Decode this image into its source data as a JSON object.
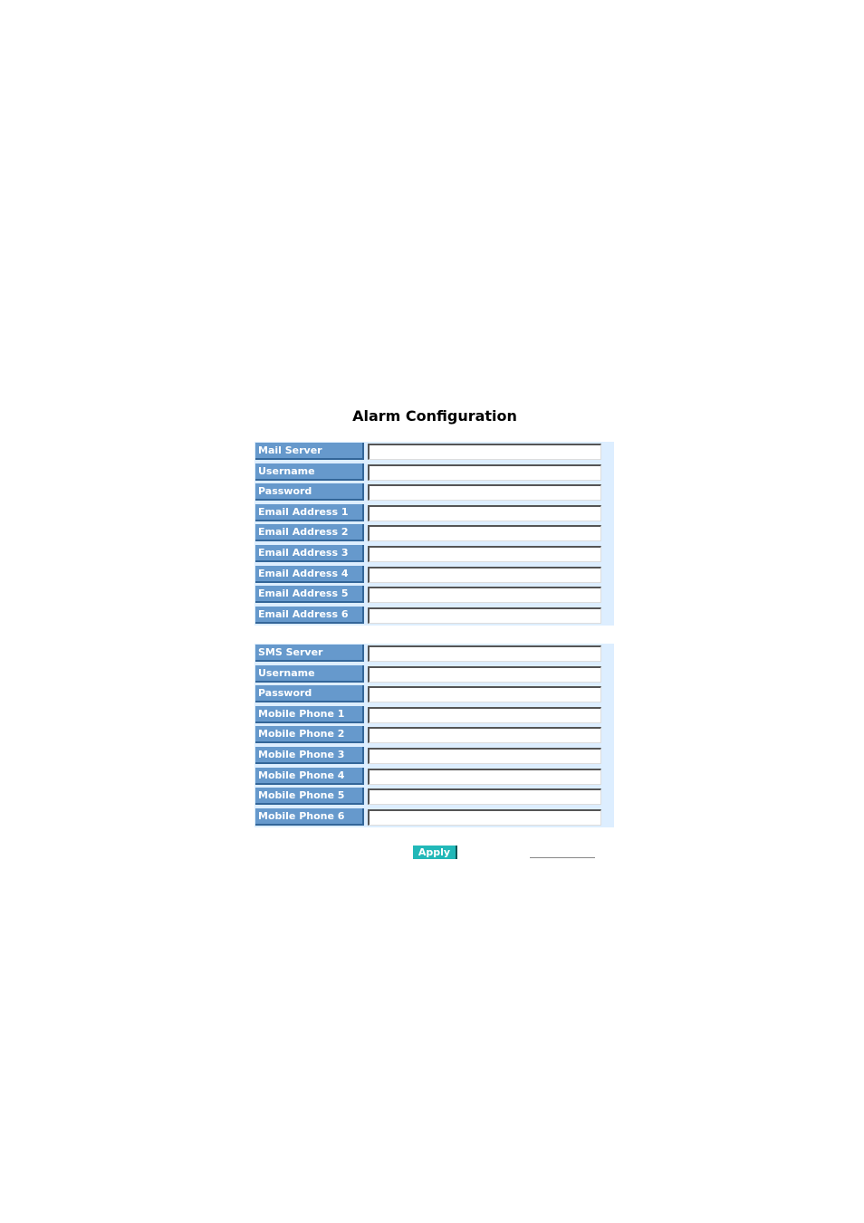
{
  "page": {
    "title": "Alarm Configuration"
  },
  "email_group": {
    "rows": [
      {
        "label": "Mail Server",
        "value": ""
      },
      {
        "label": "Username",
        "value": ""
      },
      {
        "label": "Password",
        "value": ""
      },
      {
        "label": "Email Address 1",
        "value": ""
      },
      {
        "label": "Email Address 2",
        "value": ""
      },
      {
        "label": "Email Address 3",
        "value": ""
      },
      {
        "label": "Email Address 4",
        "value": ""
      },
      {
        "label": "Email Address 5",
        "value": ""
      },
      {
        "label": "Email Address 6",
        "value": ""
      }
    ]
  },
  "sms_group": {
    "rows": [
      {
        "label": "SMS Server",
        "value": ""
      },
      {
        "label": "Username",
        "value": ""
      },
      {
        "label": "Password",
        "value": ""
      },
      {
        "label": "Mobile Phone 1",
        "value": ""
      },
      {
        "label": "Mobile Phone 2",
        "value": ""
      },
      {
        "label": "Mobile Phone 3",
        "value": ""
      },
      {
        "label": "Mobile Phone 4",
        "value": ""
      },
      {
        "label": "Mobile Phone 5",
        "value": ""
      },
      {
        "label": "Mobile Phone 6",
        "value": ""
      }
    ]
  },
  "actions": {
    "apply_label": "Apply"
  }
}
